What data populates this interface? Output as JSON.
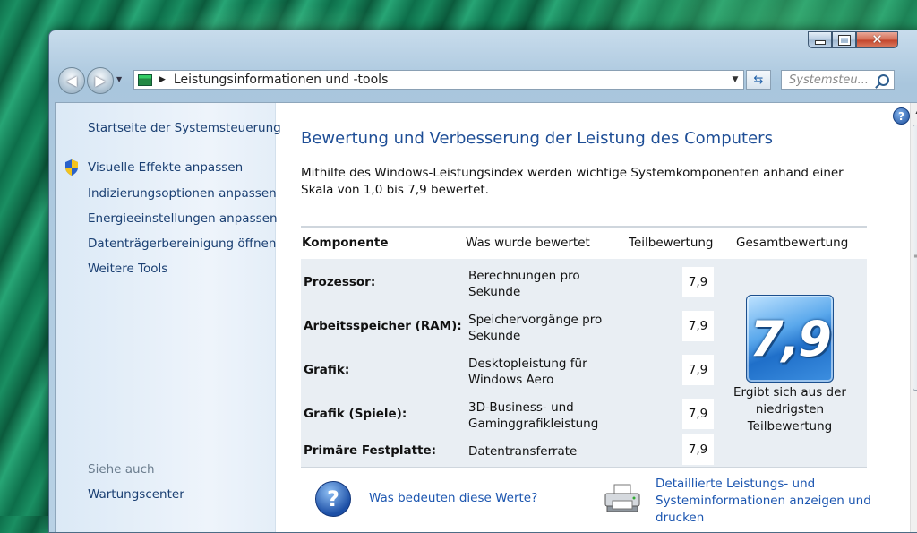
{
  "window": {
    "address": {
      "crumb": "Leistungsinformationen und -tools"
    },
    "search": {
      "placeholder": "Systemsteu..."
    },
    "controls": {
      "min": "",
      "max": "",
      "close": "✕"
    }
  },
  "sidebar": {
    "home_link": "Startseite der Systemsteuerung",
    "tasks": [
      {
        "label": "Visuelle Effekte anpassen",
        "icon": "shield-icon"
      },
      {
        "label": "Indizierungsoptionen anpassen"
      },
      {
        "label": "Energieeinstellungen anpassen"
      },
      {
        "label": "Datenträgerbereinigung öffnen"
      },
      {
        "label": "Weitere Tools"
      }
    ],
    "see_also": {
      "label": "Siehe auch",
      "items": [
        "Wartungscenter"
      ]
    }
  },
  "main": {
    "title": "Bewertung und Verbesserung der Leistung des Computers",
    "description": "Mithilfe des Windows-Leistungsindex werden wichtige Systemkomponenten anhand einer Skala von 1,0 bis 7,9 bewertet.",
    "table": {
      "headers": [
        "Komponente",
        "Was wurde bewertet",
        "Teilbewertung",
        "Gesamtbewertung"
      ],
      "rows": [
        {
          "component": "Prozessor:",
          "rated": "Berechnungen pro Sekunde",
          "score": "7,9"
        },
        {
          "component": "Arbeitsspeicher (RAM):",
          "rated": "Speichervorgänge pro Sekunde",
          "score": "7,9"
        },
        {
          "component": "Grafik:",
          "rated": "Desktopleistung für Windows Aero",
          "score": "7,9"
        },
        {
          "component": "Grafik (Spiele):",
          "rated": "3D-Business- und Gaminggrafikleistung",
          "score": "7,9"
        },
        {
          "component": "Primäre Festplatte:",
          "rated": "Datentransferrate",
          "score": "7,9"
        }
      ],
      "base_score": "7,9",
      "base_caption": "Ergibt sich aus der niedrigsten Teilbewertung"
    },
    "links": {
      "what_mean": "Was bedeuten diese Werte?",
      "details": "Detaillierte Leistungs- und Systeminformationen anzeigen und drucken"
    }
  }
}
